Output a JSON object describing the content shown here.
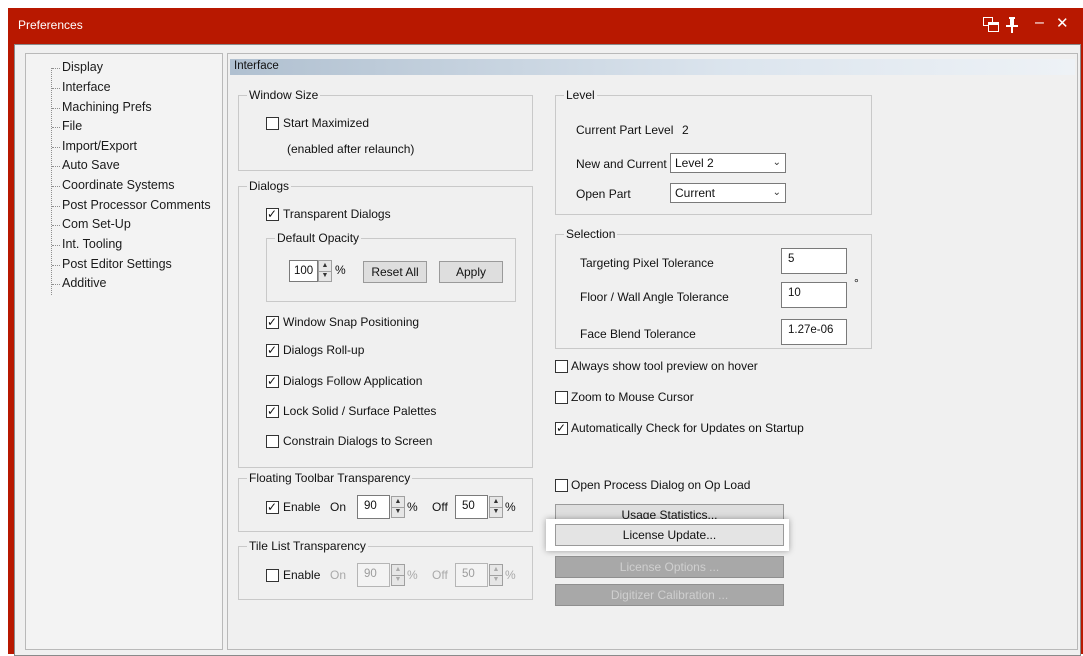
{
  "window": {
    "title": "Preferences",
    "icons": {
      "restore": "dock-icon",
      "pin": "pin-icon",
      "minimize": "minimize-icon",
      "close": "close-icon"
    },
    "minimize_glyph": "–",
    "close_glyph": "✕",
    "accent": "#b81800"
  },
  "tree": {
    "items": [
      "Display",
      "Interface",
      "Machining Prefs",
      "File",
      "Import/Export",
      "Auto Save",
      "Coordinate Systems",
      "Post Processor Comments",
      "Com Set-Up",
      "Int. Tooling",
      "Post Editor Settings",
      "Additive"
    ],
    "selected": "Interface"
  },
  "panel": {
    "header": "Interface",
    "window_size": {
      "legend": "Window Size",
      "start_maximized": {
        "label": "Start Maximized",
        "checked": false
      },
      "note": "(enabled after relaunch)"
    },
    "dialogs": {
      "legend": "Dialogs",
      "transparent": {
        "label": "Transparent Dialogs",
        "checked": true
      },
      "opacity": {
        "legend": "Default Opacity",
        "value": "100",
        "unit": "%",
        "reset_label": "Reset All",
        "apply_label": "Apply"
      },
      "snap": {
        "label": "Window Snap Positioning",
        "checked": true
      },
      "rollup": {
        "label": "Dialogs Roll-up",
        "checked": true
      },
      "follow": {
        "label": "Dialogs Follow Application",
        "checked": true
      },
      "lock": {
        "label": "Lock Solid / Surface Palettes",
        "checked": true
      },
      "constrain": {
        "label": "Constrain Dialogs to Screen",
        "checked": false
      }
    },
    "floating": {
      "legend": "Floating Toolbar Transparency",
      "enable_label": "Enable",
      "enabled": true,
      "on_label": "On",
      "on_value": "90",
      "off_label": "Off",
      "off_value": "50",
      "unit": "%"
    },
    "tile": {
      "legend": "Tile List Transparency",
      "enable_label": "Enable",
      "enabled": false,
      "on_label": "On",
      "on_value": "90",
      "off_label": "Off",
      "off_value": "50",
      "unit": "%"
    },
    "level": {
      "legend": "Level",
      "current_label": "Current Part Level",
      "current_value": "2",
      "new_label": "New and Current",
      "new_value": "Level 2",
      "open_label": "Open Part",
      "open_value": "Current"
    },
    "selection": {
      "legend": "Selection",
      "pixel_label": "Targeting Pixel Tolerance",
      "pixel_value": "5",
      "angle_label": "Floor / Wall Angle Tolerance",
      "angle_value": "10",
      "angle_unit": "°",
      "blend_label": "Face Blend Tolerance",
      "blend_value": "1.27e-06"
    },
    "options": {
      "tool_preview": {
        "label": "Always show tool preview on hover",
        "checked": false
      },
      "zoom_cursor": {
        "label": "Zoom to Mouse Cursor",
        "checked": false
      },
      "auto_update": {
        "label": "Automatically Check for Updates on Startup",
        "checked": true
      },
      "process_dialog": {
        "label": "Open Process Dialog on Op Load",
        "checked": false
      }
    },
    "buttons": {
      "usage": "Usage Statistics...",
      "license_update": "License Update...",
      "license_options": "License Options ...",
      "digitizer": "Digitizer Calibration ..."
    },
    "check_glyph": "✓",
    "spin_up": "▲",
    "spin_down": "▼",
    "combo_arrow": "⌄"
  }
}
